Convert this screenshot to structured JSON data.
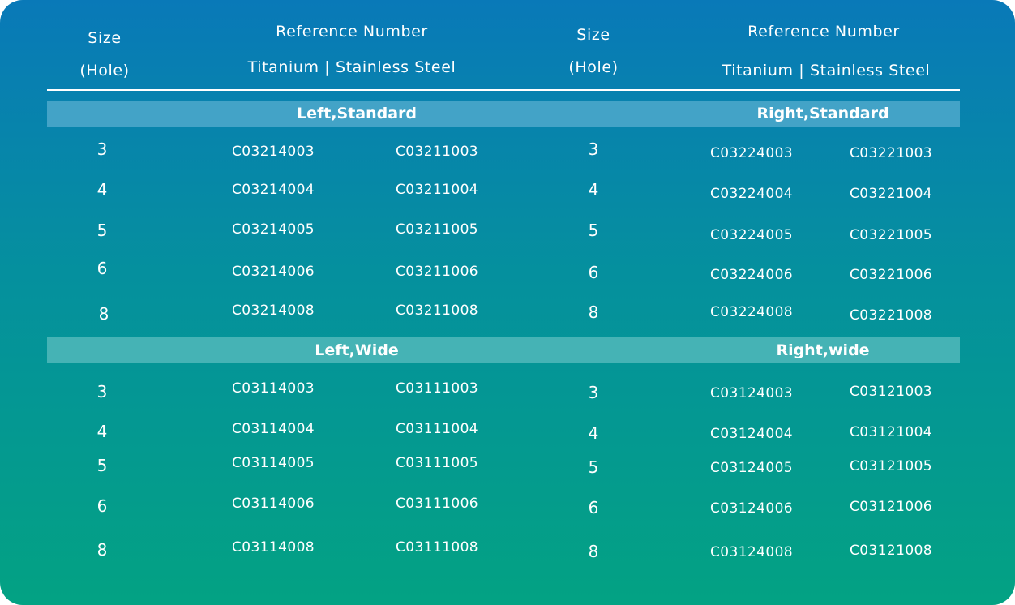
{
  "header": {
    "left": {
      "size_line1": "Size",
      "size_line2": "(Hole)",
      "ref_line1": "Reference Number",
      "ref_line2": "Titanium | Stainless Steel"
    },
    "right": {
      "size_line1": "Size",
      "size_line2": "(Hole)",
      "ref_line1": "Reference Number",
      "ref_line2": "Titanium | Stainless Steel"
    }
  },
  "sections": {
    "left_standard": {
      "title": "Left,Standard",
      "rows": [
        {
          "size": "3",
          "titanium": "C03214003",
          "steel": "C03211003"
        },
        {
          "size": "4",
          "titanium": "C03214004",
          "steel": "C03211004"
        },
        {
          "size": "5",
          "titanium": "C03214005",
          "steel": "C03211005"
        },
        {
          "size": "6",
          "titanium": "C03214006",
          "steel": "C03211006"
        },
        {
          "size": "8",
          "titanium": "C03214008",
          "steel": "C03211008"
        }
      ]
    },
    "right_standard": {
      "title": "Right,Standard",
      "rows": [
        {
          "size": "3",
          "titanium": "C03224003",
          "steel": "C03221003"
        },
        {
          "size": "4",
          "titanium": "C03224004",
          "steel": "C03221004"
        },
        {
          "size": "5",
          "titanium": "C03224005",
          "steel": "C03221005"
        },
        {
          "size": "6",
          "titanium": "C03224006",
          "steel": "C03221006"
        },
        {
          "size": "8",
          "titanium": "C03224008",
          "steel": "C03221008"
        }
      ]
    },
    "left_wide": {
      "title": "Left,Wide",
      "rows": [
        {
          "size": "3",
          "titanium": "C03114003",
          "steel": "C03111003"
        },
        {
          "size": "4",
          "titanium": "C03114004",
          "steel": "C03111004"
        },
        {
          "size": "5",
          "titanium": "C03114005",
          "steel": "C03111005"
        },
        {
          "size": "6",
          "titanium": "C03114006",
          "steel": "C03111006"
        },
        {
          "size": "8",
          "titanium": "C03114008",
          "steel": "C03111008"
        }
      ]
    },
    "right_wide": {
      "title": "Right,wide",
      "rows": [
        {
          "size": "3",
          "titanium": "C03124003",
          "steel": "C03121003"
        },
        {
          "size": "4",
          "titanium": "C03124004",
          "steel": "C03121004"
        },
        {
          "size": "5",
          "titanium": "C03124005",
          "steel": "C03121005"
        },
        {
          "size": "6",
          "titanium": "C03124006",
          "steel": "C03121006"
        },
        {
          "size": "8",
          "titanium": "C03124008",
          "steel": "C03121008"
        }
      ]
    }
  }
}
